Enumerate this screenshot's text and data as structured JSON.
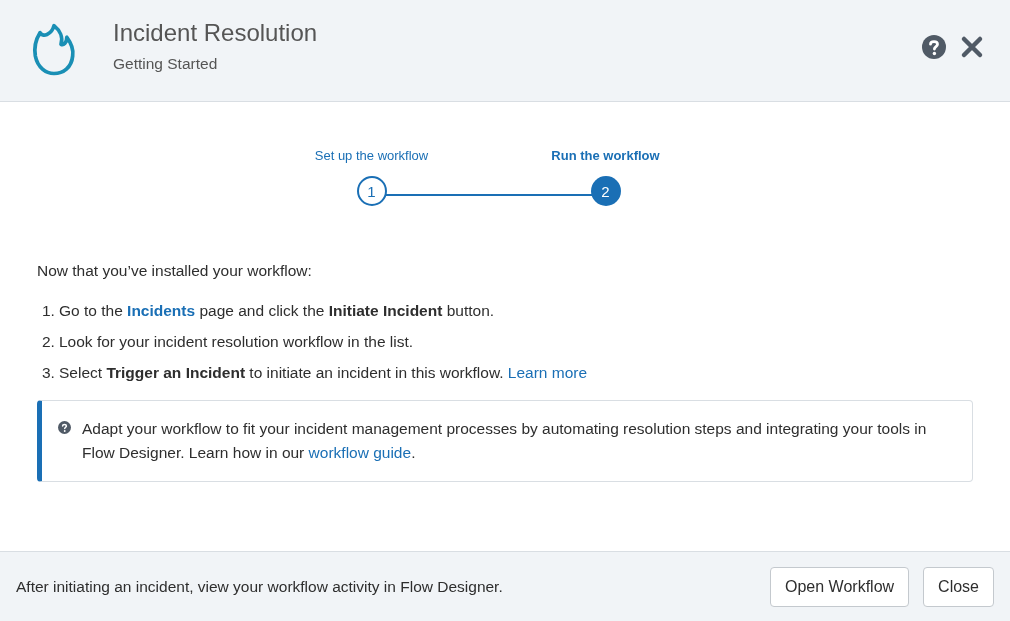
{
  "header": {
    "title": "Incident Resolution",
    "subtitle": "Getting Started"
  },
  "stepper": [
    {
      "label": "Set up the workflow",
      "number": "1",
      "selected": false
    },
    {
      "label": "Run the workflow",
      "number": "2",
      "selected": true
    }
  ],
  "intro": "Now that you’ve installed your workflow:",
  "steps": [
    {
      "number": "1.",
      "segments": [
        {
          "kind": "text",
          "text": "Go to the "
        },
        {
          "kind": "link",
          "text": "Incidents",
          "bold": true
        },
        {
          "kind": "text",
          "text": " page and click the **Initiate Incident** button."
        }
      ]
    },
    {
      "number": "2.",
      "segments": [
        {
          "kind": "text",
          "text": "Look for your incident resolution workflow in the list."
        }
      ]
    },
    {
      "number": "3.",
      "segments": [
        {
          "kind": "text",
          "text": "Select **Trigger an Incident** to initiate an incident in this workflow. "
        },
        {
          "kind": "link",
          "text": "Learn more",
          "bold": false
        }
      ]
    }
  ],
  "note": {
    "segments": [
      {
        "kind": "text",
        "text": "Adapt your workflow to fit your incident management processes by automating resolution steps and integrating your tools in Flow Designer. Learn how in our "
      },
      {
        "kind": "link",
        "text": "workflow guide",
        "bold": false
      },
      {
        "kind": "text",
        "text": "."
      }
    ]
  },
  "footer": {
    "text": "After initiating an incident, view your workflow activity in Flow Designer.",
    "buttons": [
      "Open Workflow",
      "Close"
    ]
  }
}
